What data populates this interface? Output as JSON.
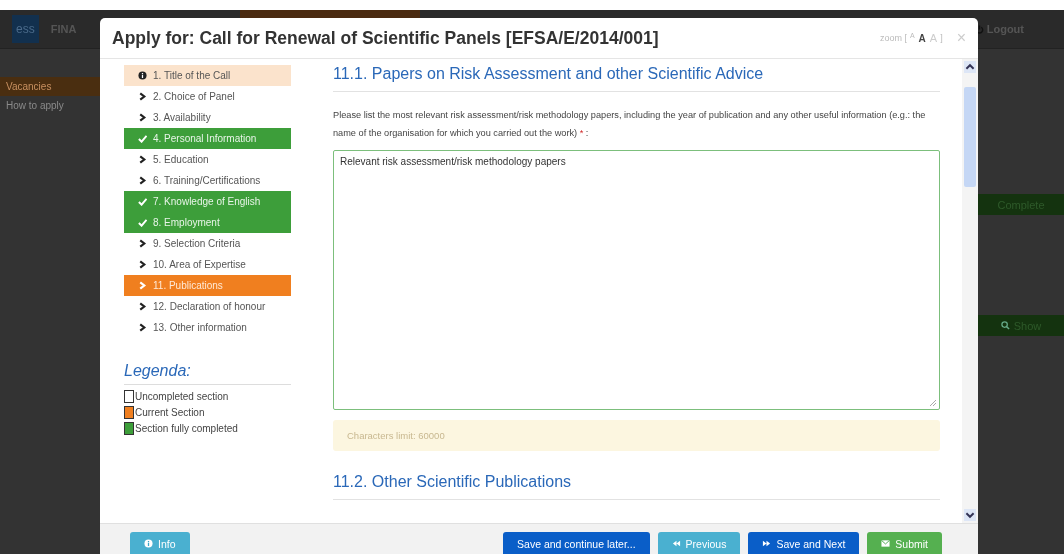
{
  "background": {
    "logo": "ess",
    "nav_label": "FINA",
    "side_links": [
      {
        "label": "Vacancies",
        "selected": true
      },
      {
        "label": "How to apply",
        "selected": false
      }
    ],
    "logout": "Logout",
    "buttons": [
      {
        "label": "Complete",
        "kind": "plain"
      },
      {
        "label": "Show",
        "kind": "search"
      }
    ]
  },
  "dialog": {
    "title": "Apply for: Call for Renewal of Scientific Panels [EFSA/E/2014/001]",
    "zoom_label": "zoom [",
    "zoom_sizes": [
      "A",
      "A",
      "A"
    ],
    "zoom_end": "]",
    "close": "×",
    "steps": [
      {
        "label": "1. Title of the Call",
        "kind": "intro"
      },
      {
        "label": "2. Choice of Panel",
        "kind": "incomplete"
      },
      {
        "label": "3. Availability",
        "kind": "incomplete"
      },
      {
        "label": "4. Personal Information",
        "kind": "complete"
      },
      {
        "label": "5. Education",
        "kind": "incomplete"
      },
      {
        "label": "6. Training/Certifications",
        "kind": "incomplete"
      },
      {
        "label": "7. Knowledge of English",
        "kind": "complete"
      },
      {
        "label": "8. Employment",
        "kind": "complete"
      },
      {
        "label": "9. Selection Criteria",
        "kind": "incomplete"
      },
      {
        "label": "10. Area of Expertise",
        "kind": "incomplete"
      },
      {
        "label": "11. Publications",
        "kind": "current"
      },
      {
        "label": "12. Declaration of honour",
        "kind": "incomplete"
      },
      {
        "label": "13. Other information",
        "kind": "incomplete"
      }
    ],
    "legend": {
      "title": "Legenda:",
      "items": [
        {
          "label": "Uncompleted section",
          "color": "#ffffff"
        },
        {
          "label": "Current Section",
          "color": "#f07f1f"
        },
        {
          "label": "Section fully completed",
          "color": "#3d9e3a"
        }
      ]
    },
    "section_1": {
      "heading": "11.1. Papers on Risk Assessment and other Scientific Advice",
      "prompt": "Please list the most relevant risk assessment/risk methodology papers, including the year of publication and any other useful information (e.g.: the name of the organisation for which you carried out the work)",
      "required_mark": "*",
      "prompt_end": ":",
      "value": "Relevant risk assessment/risk methodology papers",
      "limit": "Characters limit: 60000"
    },
    "section_2": {
      "heading": "11.2. Other Scientific Publications"
    },
    "footer": {
      "info": "Info",
      "save_later": "Save and continue later...",
      "previous": "Previous",
      "save_next": "Save and Next",
      "submit": "Submit"
    }
  }
}
